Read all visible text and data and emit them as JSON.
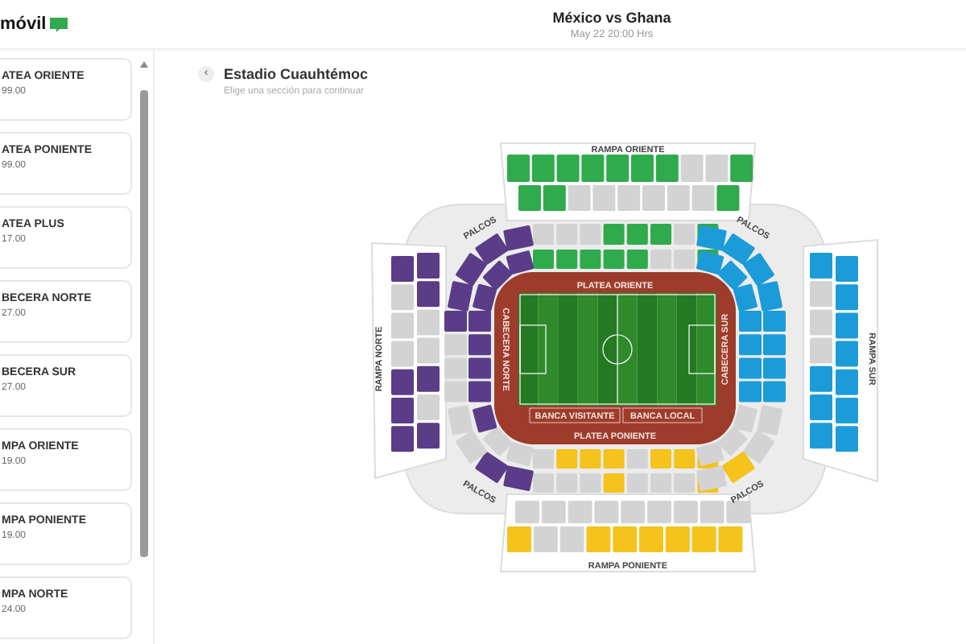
{
  "header": {
    "logo": "móvil",
    "title": "México vs Ghana",
    "date": "May 22 20:00 Hrs"
  },
  "sidebar": {
    "items": [
      {
        "name": "ATEA ORIENTE",
        "price": "99.00"
      },
      {
        "name": "ATEA PONIENTE",
        "price": "99.00"
      },
      {
        "name": "ATEA PLUS",
        "price": "17.00"
      },
      {
        "name": "BECERA NORTE",
        "price": "27.00"
      },
      {
        "name": "BECERA SUR",
        "price": "27.00"
      },
      {
        "name": "MPA ORIENTE",
        "price": "19.00"
      },
      {
        "name": "MPA PONIENTE",
        "price": "19.00"
      },
      {
        "name": "MPA NORTE",
        "price": "24.00"
      }
    ]
  },
  "venue": {
    "back": "‹",
    "title": "Estadio Cuauhtémoc",
    "subtitle": "Elige una sección para continuar"
  },
  "map": {
    "ramp_east": "RAMPA ORIENTE",
    "platea_east": "PLATEA ORIENTE",
    "platea_west": "PLATEA PONIENTE",
    "ramp_west": "RAMPA PONIENTE",
    "bench_away": "BANCA VISITANTE",
    "bench_home": "BANCA LOCAL",
    "end_north": "CABECERA NORTE",
    "end_south": "CABECERA SUR",
    "ramp_north": "RAMPA NORTE",
    "ramp_south": "RAMPA SUR",
    "boxes": [
      "PALCOS",
      "PALCOS",
      "PALCOS",
      "PALCOS"
    ]
  }
}
